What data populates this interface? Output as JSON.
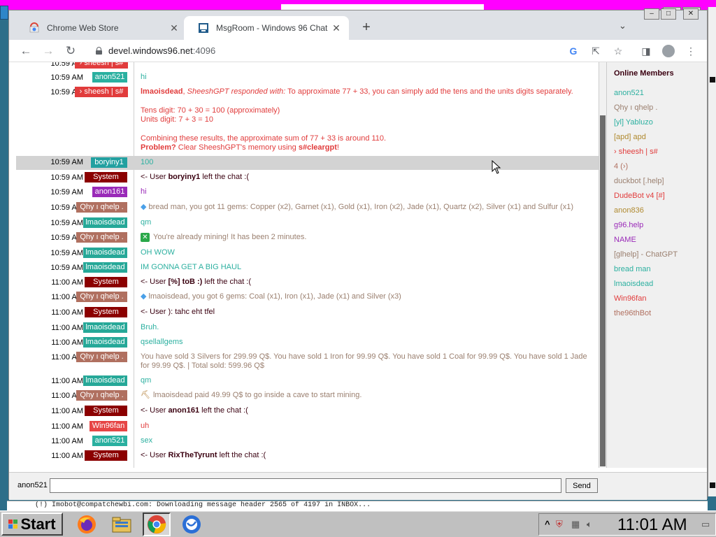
{
  "browser": {
    "tabs": [
      {
        "title": "Chrome Web Store",
        "active": false
      },
      {
        "title": "MsgRoom - Windows 96 Chat",
        "active": true
      }
    ],
    "url_host": "devel.windows96.net",
    "url_port": ":4096"
  },
  "chat": {
    "messages": [
      {
        "time": "10:59 AM",
        "nick": "anon521",
        "text": "hi"
      },
      {
        "time": "10:59 AM",
        "nick": "› sheesh | s#",
        "text_bold": "lmaoisdead",
        "text_italic": "SheeshGPT responded with:",
        "text": "To approximate 77 + 33, you can simply add the tens and the units digits separately.",
        "lines": [
          "Tens digit: 70 + 30 = 100 (approximately)",
          "Units digit: 7 + 3 = 10",
          "Combining these results, the approximate sum of 77 + 33 is around 110."
        ],
        "problem_label": "Problem?",
        "problem_text": "Clear SheeshGPT's memory using",
        "problem_cmd": "s#cleargpt",
        "problem_end": "!"
      },
      {
        "time": "10:59 AM",
        "nick": "boryiny1",
        "text": "100"
      },
      {
        "time": "10:59 AM",
        "nick": "System",
        "text_pre": "<- User",
        "text_bold": "boryiny1",
        "text": "left the chat :("
      },
      {
        "time": "10:59 AM",
        "nick": "anon161",
        "text": "hi"
      },
      {
        "time": "10:59 AM",
        "nick": "Qhy ı qhelp .",
        "text": "bread man, you got 11 gems: Copper (x2), Garnet (x1), Gold (x1), Iron (x2), Jade (x1), Quartz (x2), Silver (x1) and Sulfur (x1)"
      },
      {
        "time": "10:59 AM",
        "nick": "lmaoisdead",
        "text": "qm"
      },
      {
        "time": "10:59 AM",
        "nick": "Qhy ı qhelp .",
        "text": "You're already mining! It has been 2 minutes."
      },
      {
        "time": "10:59 AM",
        "nick": "lmaoisdead",
        "text": "OH WOW"
      },
      {
        "time": "10:59 AM",
        "nick": "lmaoisdead",
        "text": "IM GONNA GET A BIG HAUL"
      },
      {
        "time": "11:00 AM",
        "nick": "System",
        "text_pre": "<- User",
        "text_bold": "[%] toB :)",
        "text": "left the chat :("
      },
      {
        "time": "11:00 AM",
        "nick": "Qhy ı qhelp .",
        "text": "lmaoisdead, you got 6 gems: Coal (x1), Iron (x1), Jade (x1) and Silver (x3)"
      },
      {
        "time": "11:00 AM",
        "nick": "System",
        "text_pre": "<- User",
        "text": "): tahc eht tfel"
      },
      {
        "time": "11:00 AM",
        "nick": "lmaoisdead",
        "text": "Bruh."
      },
      {
        "time": "11:00 AM",
        "nick": "lmaoisdead",
        "text": "qsellallgems"
      },
      {
        "time": "11:00 AM",
        "nick": "Qhy ı qhelp .",
        "text": "You have sold 3 Silvers for 299.99 Q$. You have sold 1 Iron for 99.99 Q$. You have sold 1 Coal for 99.99 Q$. You have sold 1 Jade for 99.99 Q$. | Total sold: 599.96 Q$"
      },
      {
        "time": "11:00 AM",
        "nick": "lmaoisdead",
        "text": "qm"
      },
      {
        "time": "11:00 AM",
        "nick": "Qhy ı qhelp .",
        "text": "lmaoisdead paid 49.99 Q$ to go inside a cave to start mining."
      },
      {
        "time": "11:00 AM",
        "nick": "System",
        "text_pre": "<- User",
        "text_bold": "anon161",
        "text": "left the chat :("
      },
      {
        "time": "11:00 AM",
        "nick": "Win96fan",
        "text": "uh"
      },
      {
        "time": "11:00 AM",
        "nick": "anon521",
        "text": "sex"
      },
      {
        "time": "11:00 AM",
        "nick": "System",
        "text_pre": "<- User",
        "text_bold": "RixTheTyrunt",
        "text": "left the chat :("
      }
    ]
  },
  "members": {
    "title": "Online Members",
    "list": [
      "anon521",
      "Qhy ı qhelp .",
      "[yl] Yabluzo",
      "[apd] apd",
      "› sheesh | s#",
      "4 (›)",
      "duckbot [.help]",
      "DudeBot v4 [#]",
      "anon836",
      "g96.help",
      "NAME",
      "[glhelp] - ChatGPT",
      "bread man",
      "lmaoisdead",
      "Win96fan",
      "the96thBot"
    ]
  },
  "input": {
    "username": "anon521",
    "placeholder": "",
    "send_label": "Send"
  },
  "taskbar": {
    "start_label": "Start",
    "clock": "11:01 AM"
  },
  "status_bar_text": "(!)  Imobot@compatchewbi.com: Downloading message header 2565 of 4197 in INBOX..."
}
